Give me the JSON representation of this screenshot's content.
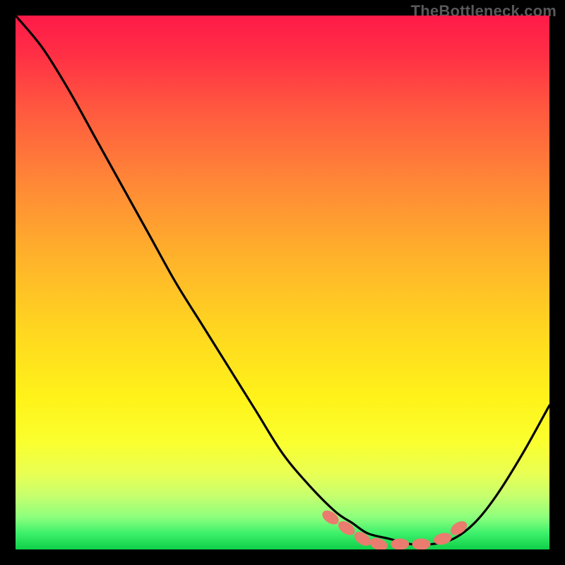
{
  "watermark": {
    "text": "TheBottleneck.com"
  },
  "chart_data": {
    "type": "line",
    "title": "",
    "xlabel": "",
    "ylabel": "",
    "xlim": [
      0,
      100
    ],
    "ylim": [
      0,
      100
    ],
    "gradient_stops": [
      {
        "pct": 0,
        "color": "#ff1a49"
      },
      {
        "pct": 7,
        "color": "#ff2e45"
      },
      {
        "pct": 18,
        "color": "#ff5a3f"
      },
      {
        "pct": 32,
        "color": "#ff8a36"
      },
      {
        "pct": 46,
        "color": "#ffb42a"
      },
      {
        "pct": 60,
        "color": "#ffd91f"
      },
      {
        "pct": 72,
        "color": "#fff31a"
      },
      {
        "pct": 80,
        "color": "#faff2f"
      },
      {
        "pct": 86,
        "color": "#e8ff55"
      },
      {
        "pct": 90,
        "color": "#c6ff6e"
      },
      {
        "pct": 94,
        "color": "#8cff7d"
      },
      {
        "pct": 97,
        "color": "#3cf06b"
      },
      {
        "pct": 100,
        "color": "#0fcf49"
      }
    ],
    "series": [
      {
        "name": "curve",
        "x": [
          0,
          5,
          10,
          15,
          20,
          25,
          30,
          35,
          40,
          45,
          50,
          55,
          60,
          63,
          66,
          70,
          74,
          78,
          82,
          86,
          90,
          95,
          100
        ],
        "y": [
          100,
          94,
          86,
          77,
          68,
          59,
          50,
          42,
          34,
          26,
          18,
          12,
          7,
          5,
          3,
          2,
          1,
          1,
          2,
          5,
          10,
          18,
          27
        ]
      }
    ],
    "markers": {
      "name": "highlight-dots",
      "color": "#e97c6e",
      "x": [
        59,
        62,
        65,
        68,
        72,
        76,
        80,
        83
      ],
      "y": [
        6,
        4,
        2,
        1,
        1,
        1,
        2,
        4
      ]
    }
  }
}
